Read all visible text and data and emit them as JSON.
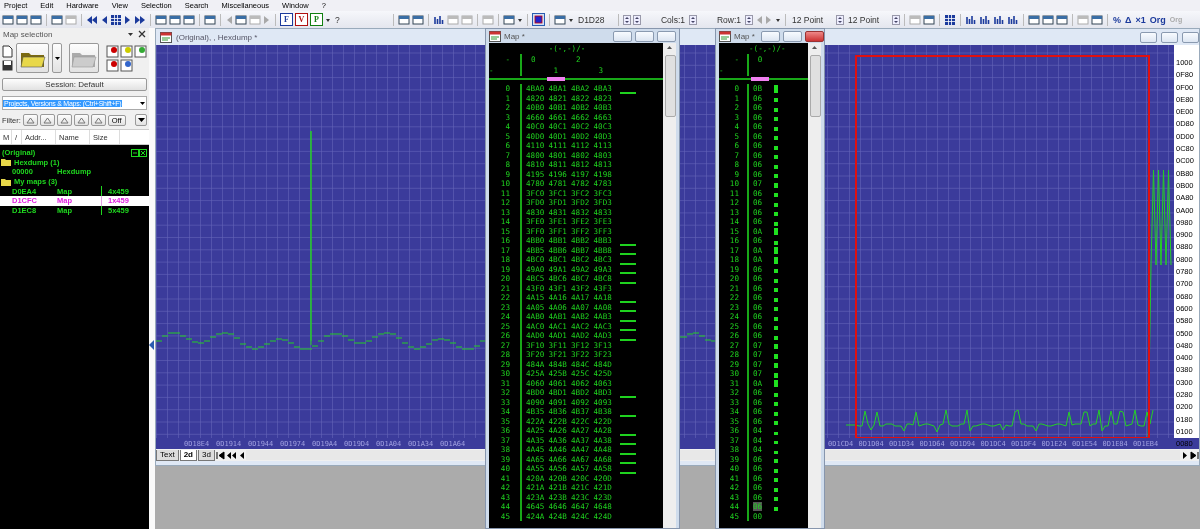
{
  "menu": [
    "Project",
    "Edit",
    "Hardware",
    "View",
    "Selection",
    "Search",
    "Miscellaneous",
    "Window",
    "?"
  ],
  "toolbar": {
    "fields": [
      "?",
      "D1D28",
      "Cols:1",
      "Row:1",
      "12 Point",
      "12 Point"
    ],
    "letters": [
      "F",
      "V",
      "P"
    ],
    "symbols": [
      {
        "text": "%",
        "disabled": false
      },
      {
        "text": "Δ",
        "disabled": false
      },
      {
        "text": "×1",
        "disabled": false
      },
      {
        "text": "Org",
        "disabled": false
      },
      {
        "text": "Org",
        "disabled": true
      }
    ]
  },
  "map_selection": {
    "title": "Map selection",
    "session_button": "Session: Default",
    "search_combo": "Projects, Versions & Maps:  (Ctrl+Shift+F)",
    "filter_label": "Filter:",
    "filter_off_button": "Off",
    "columns": [
      "M",
      "/",
      "Addr...",
      "Name",
      "Size"
    ],
    "tree": [
      {
        "kind": "root",
        "label": "(Original)",
        "children": [
          {
            "kind": "folder",
            "label": "Hexdump (1)",
            "children": [
              {
                "kind": "item",
                "address": "00000",
                "name": "Hexdump",
                "selected": false
              }
            ]
          },
          {
            "kind": "folder",
            "label": "My maps (3)",
            "children": [
              {
                "kind": "item",
                "address": "D0EA4",
                "name": "Map",
                "size": "4x459",
                "selected": false
              },
              {
                "kind": "item",
                "address": "D1CFC",
                "name": "Map",
                "size": "1x459",
                "selected": true
              },
              {
                "kind": "item",
                "address": "D1EC8",
                "name": "Map",
                "size": "5x459",
                "selected": false
              }
            ]
          }
        ]
      }
    ]
  },
  "hexdump_window": {
    "title": "(Original), , Hexdump *",
    "x_axis_labels_left": [
      "0D18E4",
      "0D1914",
      "0D1944",
      "0D1974",
      "0D19A4",
      "0D19D4",
      "0D1A04",
      "0D1A34",
      "0D1A64"
    ],
    "x_axis_labels_right": [
      "0D1CD4",
      "0D1D04",
      "0D1D34",
      "0D1D64",
      "0D1D94",
      "0D1DC4",
      "0D1DF4",
      "0D1E24",
      "0D1E54",
      "0D1E84",
      "0D1EB4"
    ],
    "y_axis_labels": [
      "1000",
      "0F80",
      "0F00",
      "0E80",
      "0E00",
      "0D80",
      "0D00",
      "0C80",
      "0C00",
      "0B80",
      "0B00",
      "0A80",
      "0A00",
      "0980",
      "0900",
      "0880",
      "0800",
      "0780",
      "0700",
      "0680",
      "0600",
      "0580",
      "0500",
      "0480",
      "0400",
      "0380",
      "0300",
      "0280",
      "0200",
      "0180",
      "0100",
      "0080"
    ],
    "tabs": [
      {
        "label": "Text",
        "selected": false
      },
      {
        "label": "2d",
        "selected": true
      },
      {
        "label": "3d",
        "selected": false
      }
    ]
  },
  "maps": [
    {
      "title": "Map *",
      "active": false,
      "bars": false,
      "header": {
        "axis_label": "-(-,-)/-",
        "row_label": "-",
        "corner": "-",
        "columns": [
          {
            "label": "0",
            "selected": false
          },
          {
            "label": "1",
            "selected": true
          },
          {
            "label": "2",
            "selected": false
          },
          {
            "label": "3",
            "selected": false
          }
        ]
      },
      "rows": [
        {
          "index": "0",
          "values": [
            "4BA0",
            "4BA1",
            "4BA2",
            "4BA3"
          ],
          "marked": true,
          "selected": false
        },
        {
          "index": "1",
          "values": [
            "4820",
            "4821",
            "4822",
            "4823"
          ],
          "marked": false,
          "selected": false
        },
        {
          "index": "2",
          "values": [
            "40B0",
            "40B1",
            "40B2",
            "40B3"
          ],
          "marked": false,
          "selected": false
        },
        {
          "index": "3",
          "values": [
            "4660",
            "4661",
            "4662",
            "4663"
          ],
          "marked": false,
          "selected": false
        },
        {
          "index": "4",
          "values": [
            "40C0",
            "40C1",
            "40C2",
            "40C3"
          ],
          "marked": false,
          "selected": false
        },
        {
          "index": "5",
          "values": [
            "40D0",
            "40D1",
            "40D2",
            "40D3"
          ],
          "marked": false,
          "selected": false
        },
        {
          "index": "6",
          "values": [
            "4110",
            "4111",
            "4112",
            "4113"
          ],
          "marked": false,
          "selected": false
        },
        {
          "index": "7",
          "values": [
            "4800",
            "4801",
            "4802",
            "4803"
          ],
          "marked": false,
          "selected": false
        },
        {
          "index": "8",
          "values": [
            "4810",
            "4811",
            "4812",
            "4813"
          ],
          "marked": false,
          "selected": false
        },
        {
          "index": "9",
          "values": [
            "4195",
            "4196",
            "4197",
            "4198"
          ],
          "marked": false,
          "selected": false
        },
        {
          "index": "10",
          "values": [
            "4780",
            "4781",
            "4782",
            "4783"
          ],
          "marked": false,
          "selected": false
        },
        {
          "index": "11",
          "values": [
            "3FC0",
            "3FC1",
            "3FC2",
            "3FC3"
          ],
          "marked": false,
          "selected": false
        },
        {
          "index": "12",
          "values": [
            "3FD0",
            "3FD1",
            "3FD2",
            "3FD3"
          ],
          "marked": false,
          "selected": false
        },
        {
          "index": "13",
          "values": [
            "4830",
            "4831",
            "4832",
            "4833"
          ],
          "marked": false,
          "selected": false
        },
        {
          "index": "14",
          "values": [
            "3FE0",
            "3FE1",
            "3FE2",
            "3FE3"
          ],
          "marked": false,
          "selected": false
        },
        {
          "index": "15",
          "values": [
            "3FF0",
            "3FF1",
            "3FF2",
            "3FF3"
          ],
          "marked": false,
          "selected": false
        },
        {
          "index": "16",
          "values": [
            "4BB0",
            "4BB1",
            "4BB2",
            "4BB3"
          ],
          "marked": true,
          "selected": false
        },
        {
          "index": "17",
          "values": [
            "4BB5",
            "4BB6",
            "4BB7",
            "4BB8"
          ],
          "marked": true,
          "selected": false
        },
        {
          "index": "18",
          "values": [
            "4BC0",
            "4BC1",
            "4BC2",
            "4BC3"
          ],
          "marked": true,
          "selected": false
        },
        {
          "index": "19",
          "values": [
            "49A0",
            "49A1",
            "49A2",
            "49A3"
          ],
          "marked": true,
          "selected": false
        },
        {
          "index": "20",
          "values": [
            "4BC5",
            "4BC6",
            "4BC7",
            "4BC8"
          ],
          "marked": true,
          "selected": false
        },
        {
          "index": "21",
          "values": [
            "43F0",
            "43F1",
            "43F2",
            "43F3"
          ],
          "marked": false,
          "selected": false
        },
        {
          "index": "22",
          "values": [
            "4A15",
            "4A16",
            "4A17",
            "4A18"
          ],
          "marked": true,
          "selected": false
        },
        {
          "index": "23",
          "values": [
            "4A05",
            "4A06",
            "4A07",
            "4A08"
          ],
          "marked": true,
          "selected": false
        },
        {
          "index": "24",
          "values": [
            "4AB0",
            "4AB1",
            "4AB2",
            "4AB3"
          ],
          "marked": true,
          "selected": false
        },
        {
          "index": "25",
          "values": [
            "4AC0",
            "4AC1",
            "4AC2",
            "4AC3"
          ],
          "marked": true,
          "selected": false
        },
        {
          "index": "26",
          "values": [
            "4AD0",
            "4AD1",
            "4AD2",
            "4AD3"
          ],
          "marked": true,
          "selected": false
        },
        {
          "index": "27",
          "values": [
            "3F10",
            "3F11",
            "3F12",
            "3F13"
          ],
          "marked": false,
          "selected": false
        },
        {
          "index": "28",
          "values": [
            "3F20",
            "3F21",
            "3F22",
            "3F23"
          ],
          "marked": false,
          "selected": false
        },
        {
          "index": "29",
          "values": [
            "484A",
            "484B",
            "484C",
            "484D"
          ],
          "marked": false,
          "selected": false
        },
        {
          "index": "30",
          "values": [
            "425A",
            "425B",
            "425C",
            "425D"
          ],
          "marked": false,
          "selected": false
        },
        {
          "index": "31",
          "values": [
            "4060",
            "4061",
            "4062",
            "4063"
          ],
          "marked": false,
          "selected": false
        },
        {
          "index": "32",
          "values": [
            "4BD0",
            "4BD1",
            "4BD2",
            "4BD3"
          ],
          "marked": true,
          "selected": false
        },
        {
          "index": "33",
          "values": [
            "4090",
            "4091",
            "4092",
            "4093"
          ],
          "marked": false,
          "selected": false
        },
        {
          "index": "34",
          "values": [
            "4B35",
            "4B36",
            "4B37",
            "4B38"
          ],
          "marked": true,
          "selected": false
        },
        {
          "index": "35",
          "values": [
            "422A",
            "422B",
            "422C",
            "422D"
          ],
          "marked": false,
          "selected": false
        },
        {
          "index": "36",
          "values": [
            "4A25",
            "4A26",
            "4A27",
            "4A28"
          ],
          "marked": true,
          "selected": false
        },
        {
          "index": "37",
          "values": [
            "4A35",
            "4A36",
            "4A37",
            "4A38"
          ],
          "marked": true,
          "selected": false
        },
        {
          "index": "38",
          "values": [
            "4A45",
            "4A46",
            "4A47",
            "4A48"
          ],
          "marked": true,
          "selected": false
        },
        {
          "index": "39",
          "values": [
            "4A65",
            "4A66",
            "4A67",
            "4A68"
          ],
          "marked": true,
          "selected": false
        },
        {
          "index": "40",
          "values": [
            "4A55",
            "4A56",
            "4A57",
            "4A58"
          ],
          "marked": true,
          "selected": false
        },
        {
          "index": "41",
          "values": [
            "420A",
            "420B",
            "420C",
            "420D"
          ],
          "marked": false,
          "selected": false
        },
        {
          "index": "42",
          "values": [
            "421A",
            "421B",
            "421C",
            "421D"
          ],
          "marked": false,
          "selected": false
        },
        {
          "index": "43",
          "values": [
            "423A",
            "423B",
            "423C",
            "423D"
          ],
          "marked": false,
          "selected": false
        },
        {
          "index": "44",
          "values": [
            "4645",
            "4646",
            "4647",
            "4648"
          ],
          "marked": false,
          "selected": false
        },
        {
          "index": "45",
          "values": [
            "424A",
            "424B",
            "424C",
            "424D"
          ],
          "marked": false,
          "selected": false
        }
      ]
    },
    {
      "title": "Map *",
      "active": true,
      "bars": true,
      "header": {
        "axis_label": "-(-,-)/-",
        "row_label": "-",
        "corner": "-",
        "columns": [
          {
            "label": "0",
            "selected": true
          }
        ]
      },
      "rows": [
        {
          "index": "0",
          "values": [
            "0B"
          ],
          "selected": false
        },
        {
          "index": "1",
          "values": [
            "06"
          ],
          "selected": false
        },
        {
          "index": "2",
          "values": [
            "06"
          ],
          "selected": false
        },
        {
          "index": "3",
          "values": [
            "06"
          ],
          "selected": false
        },
        {
          "index": "4",
          "values": [
            "06"
          ],
          "selected": false
        },
        {
          "index": "5",
          "values": [
            "06"
          ],
          "selected": false
        },
        {
          "index": "6",
          "values": [
            "06"
          ],
          "selected": false
        },
        {
          "index": "7",
          "values": [
            "06"
          ],
          "selected": false
        },
        {
          "index": "8",
          "values": [
            "06"
          ],
          "selected": false
        },
        {
          "index": "9",
          "values": [
            "06"
          ],
          "selected": false
        },
        {
          "index": "10",
          "values": [
            "07"
          ],
          "selected": false
        },
        {
          "index": "11",
          "values": [
            "06"
          ],
          "selected": false
        },
        {
          "index": "12",
          "values": [
            "06"
          ],
          "selected": false
        },
        {
          "index": "13",
          "values": [
            "06"
          ],
          "selected": false
        },
        {
          "index": "14",
          "values": [
            "06"
          ],
          "selected": false
        },
        {
          "index": "15",
          "values": [
            "0A"
          ],
          "selected": false
        },
        {
          "index": "16",
          "values": [
            "06"
          ],
          "selected": false
        },
        {
          "index": "17",
          "values": [
            "0A"
          ],
          "selected": false
        },
        {
          "index": "18",
          "values": [
            "0A"
          ],
          "selected": false
        },
        {
          "index": "19",
          "values": [
            "06"
          ],
          "selected": false
        },
        {
          "index": "20",
          "values": [
            "06"
          ],
          "selected": false
        },
        {
          "index": "21",
          "values": [
            "06"
          ],
          "selected": false
        },
        {
          "index": "22",
          "values": [
            "06"
          ],
          "selected": false
        },
        {
          "index": "23",
          "values": [
            "06"
          ],
          "selected": false
        },
        {
          "index": "24",
          "values": [
            "06"
          ],
          "selected": false
        },
        {
          "index": "25",
          "values": [
            "06"
          ],
          "selected": false
        },
        {
          "index": "26",
          "values": [
            "06"
          ],
          "selected": false
        },
        {
          "index": "27",
          "values": [
            "07"
          ],
          "selected": false
        },
        {
          "index": "28",
          "values": [
            "07"
          ],
          "selected": false
        },
        {
          "index": "29",
          "values": [
            "07"
          ],
          "selected": false
        },
        {
          "index": "30",
          "values": [
            "07"
          ],
          "selected": false
        },
        {
          "index": "31",
          "values": [
            "0A"
          ],
          "selected": false
        },
        {
          "index": "32",
          "values": [
            "06"
          ],
          "selected": false
        },
        {
          "index": "33",
          "values": [
            "06"
          ],
          "selected": false
        },
        {
          "index": "34",
          "values": [
            "06"
          ],
          "selected": false
        },
        {
          "index": "35",
          "values": [
            "06"
          ],
          "selected": false
        },
        {
          "index": "36",
          "values": [
            "04"
          ],
          "selected": false
        },
        {
          "index": "37",
          "values": [
            "04"
          ],
          "selected": false
        },
        {
          "index": "38",
          "values": [
            "04"
          ],
          "selected": false
        },
        {
          "index": "39",
          "values": [
            "06"
          ],
          "selected": false
        },
        {
          "index": "40",
          "values": [
            "06"
          ],
          "selected": false
        },
        {
          "index": "41",
          "values": [
            "06"
          ],
          "selected": false
        },
        {
          "index": "42",
          "values": [
            "06"
          ],
          "selected": false
        },
        {
          "index": "43",
          "values": [
            "06"
          ],
          "selected": false
        },
        {
          "index": "44",
          "values": [
            "06"
          ],
          "selected": true
        },
        {
          "index": "45",
          "values": [
            "00"
          ],
          "selected": false
        }
      ]
    }
  ]
}
